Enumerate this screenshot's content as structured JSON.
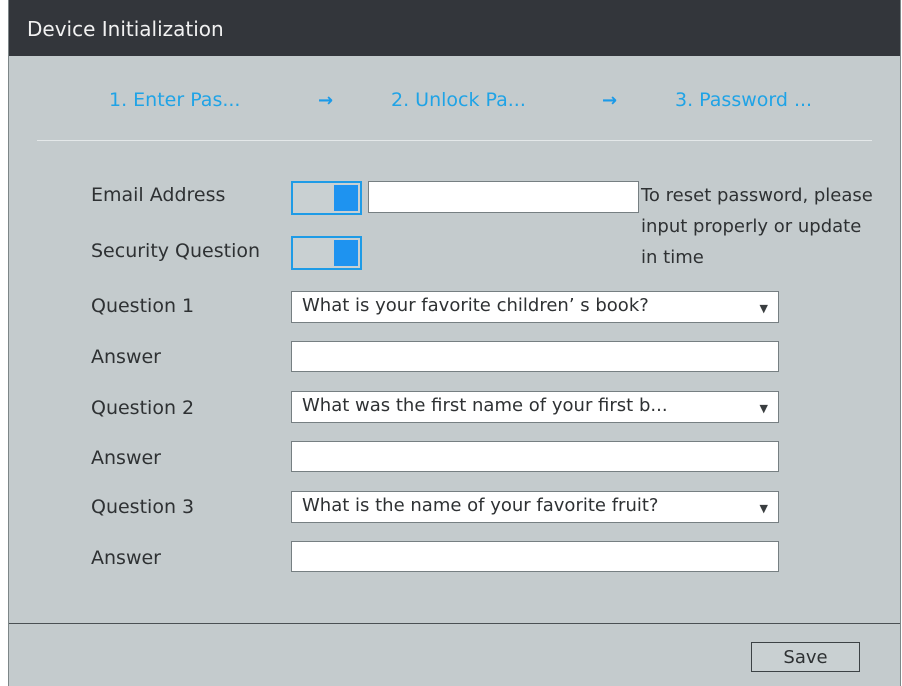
{
  "window": {
    "title": "Device Initialization"
  },
  "steps": [
    {
      "label": "1.  Enter Pas..."
    },
    {
      "label": "2.  Unlock Pa..."
    },
    {
      "label": "3.  Password ..."
    }
  ],
  "arrow": "→",
  "form": {
    "email_label": "Email Address",
    "email_value": "",
    "security_label": "Security Question",
    "email_toggle_on": true,
    "security_toggle_on": true,
    "hint": "To reset password, please input properly or update in time",
    "questions": [
      {
        "label": "Question 1",
        "selected": "What is your favorite children’ s book?",
        "answer_label": "Answer",
        "answer": ""
      },
      {
        "label": "Question 2",
        "selected": "What was the first name of your first b...",
        "answer_label": "Answer",
        "answer": ""
      },
      {
        "label": "Question 3",
        "selected": "What is the name of your favorite fruit?",
        "answer_label": "Answer",
        "answer": ""
      }
    ]
  },
  "footer": {
    "save_label": "Save"
  },
  "colors": {
    "accent": "#1e9be6",
    "title_bg": "#33363b",
    "panel_bg": "#c4cbcd"
  }
}
